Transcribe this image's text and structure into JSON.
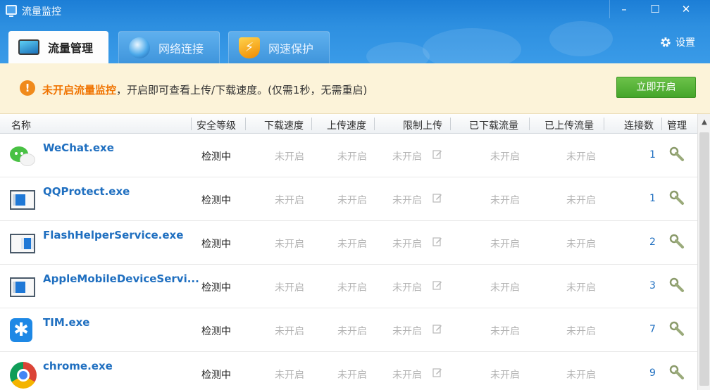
{
  "window": {
    "title": "流量监控",
    "minimize": "–",
    "maximize": "☐",
    "close": "✕"
  },
  "tabs": [
    {
      "label": "流量管理",
      "icon": "monitor-icon",
      "active": true
    },
    {
      "label": "网络连接",
      "icon": "globe-icon",
      "active": false
    },
    {
      "label": "网速保护",
      "icon": "speed-shield-icon",
      "active": false
    }
  ],
  "settings_label": "设置",
  "banner": {
    "highlight": "未开启流量监控",
    "message": "，开启即可查看上传/下载速度。(仅需1秒，无需重启)",
    "button": "立即开启"
  },
  "columns": [
    "名称",
    "安全等级",
    "下载速度",
    "上传速度",
    "限制上传",
    "已下载流量",
    "已上传流量",
    "连接数",
    "管理"
  ],
  "rows": [
    {
      "name": "WeChat.exe",
      "icon": "wechat-icon",
      "security": "检测中",
      "download_speed": "未开启",
      "upload_speed": "未开启",
      "upload_limit": "未开启",
      "downloaded": "未开启",
      "uploaded": "未开启",
      "connections": "1"
    },
    {
      "name": "QQProtect.exe",
      "icon": "window-app-icon",
      "security": "检测中",
      "download_speed": "未开启",
      "upload_speed": "未开启",
      "upload_limit": "未开启",
      "downloaded": "未开启",
      "uploaded": "未开启",
      "connections": "1"
    },
    {
      "name": "FlashHelperService.exe",
      "icon": "window-app-icon",
      "security": "检测中",
      "download_speed": "未开启",
      "upload_speed": "未开启",
      "upload_limit": "未开启",
      "downloaded": "未开启",
      "uploaded": "未开启",
      "connections": "2"
    },
    {
      "name": "AppleMobileDeviceServi...",
      "icon": "window-app-icon",
      "security": "检测中",
      "download_speed": "未开启",
      "upload_speed": "未开启",
      "upload_limit": "未开启",
      "downloaded": "未开启",
      "uploaded": "未开启",
      "connections": "3"
    },
    {
      "name": "TIM.exe",
      "icon": "tim-icon",
      "security": "检测中",
      "download_speed": "未开启",
      "upload_speed": "未开启",
      "upload_limit": "未开启",
      "downloaded": "未开启",
      "uploaded": "未开启",
      "connections": "7"
    },
    {
      "name": "chrome.exe",
      "icon": "chrome-icon",
      "security": "检测中",
      "download_speed": "未开启",
      "upload_speed": "未开启",
      "upload_limit": "未开启",
      "downloaded": "未开启",
      "uploaded": "未开启",
      "connections": "9"
    }
  ],
  "colors": {
    "header_blue": "#2d8fe0",
    "banner_bg": "#fcf3d9",
    "highlight_orange": "#f07300",
    "link_blue": "#1f6fc0",
    "button_green": "#45a52a",
    "disabled_gray": "#b3b3b3"
  }
}
